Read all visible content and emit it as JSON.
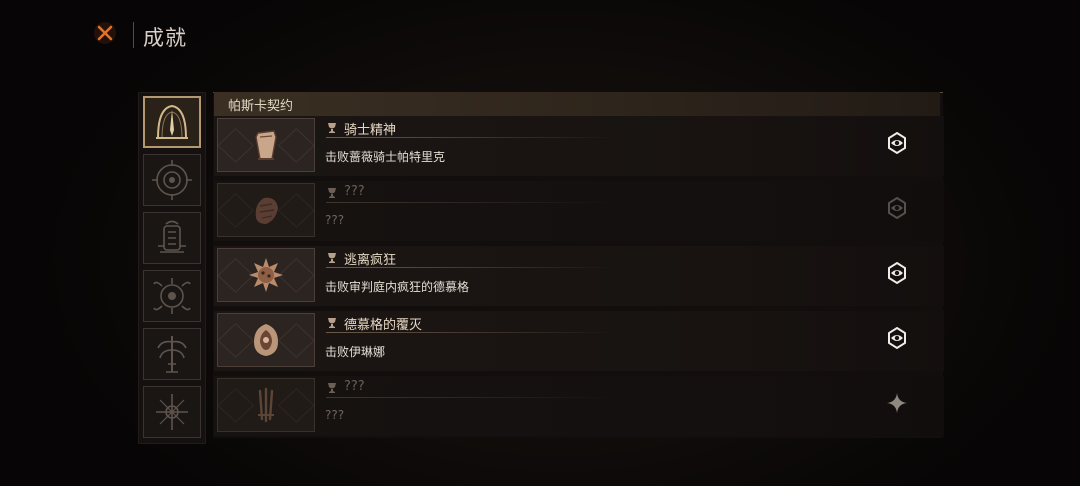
{
  "header": {
    "title": "成就",
    "close_icon": "close-x-icon",
    "accent_color": "#e0722a"
  },
  "categories": [
    {
      "icon": "arch-spike-emblem-icon",
      "active": true
    },
    {
      "icon": "eye-circle-emblem-icon",
      "active": false
    },
    {
      "icon": "lantern-emblem-icon",
      "active": false
    },
    {
      "icon": "horned-skull-emblem-icon",
      "active": false
    },
    {
      "icon": "tree-idol-emblem-icon",
      "active": false
    },
    {
      "icon": "thorn-cross-emblem-icon",
      "active": false
    }
  ],
  "section": {
    "title": "帕斯卡契约"
  },
  "achievements": [
    {
      "title": "骑士精神",
      "description": "击败蔷薇骑士帕特里克",
      "unlocked": true,
      "thumb_icon": "stone-pedestal-icon",
      "status_icon": "eye-ring-icon"
    },
    {
      "title": "???",
      "description": "???",
      "unlocked": false,
      "thumb_icon": "beast-head-icon",
      "status_icon": "eye-ring-icon"
    },
    {
      "title": "逃离疯狂",
      "description": "击败审判庭内疯狂的德慕格",
      "unlocked": true,
      "thumb_icon": "spiked-orb-icon",
      "status_icon": "eye-ring-icon"
    },
    {
      "title": "德慕格的覆灭",
      "description": "击败伊琳娜",
      "unlocked": true,
      "thumb_icon": "hooded-figure-icon",
      "status_icon": "eye-ring-icon"
    },
    {
      "title": "???",
      "description": "???",
      "unlocked": false,
      "thumb_icon": "claw-blades-icon",
      "status_icon": "four-point-star-icon"
    }
  ]
}
